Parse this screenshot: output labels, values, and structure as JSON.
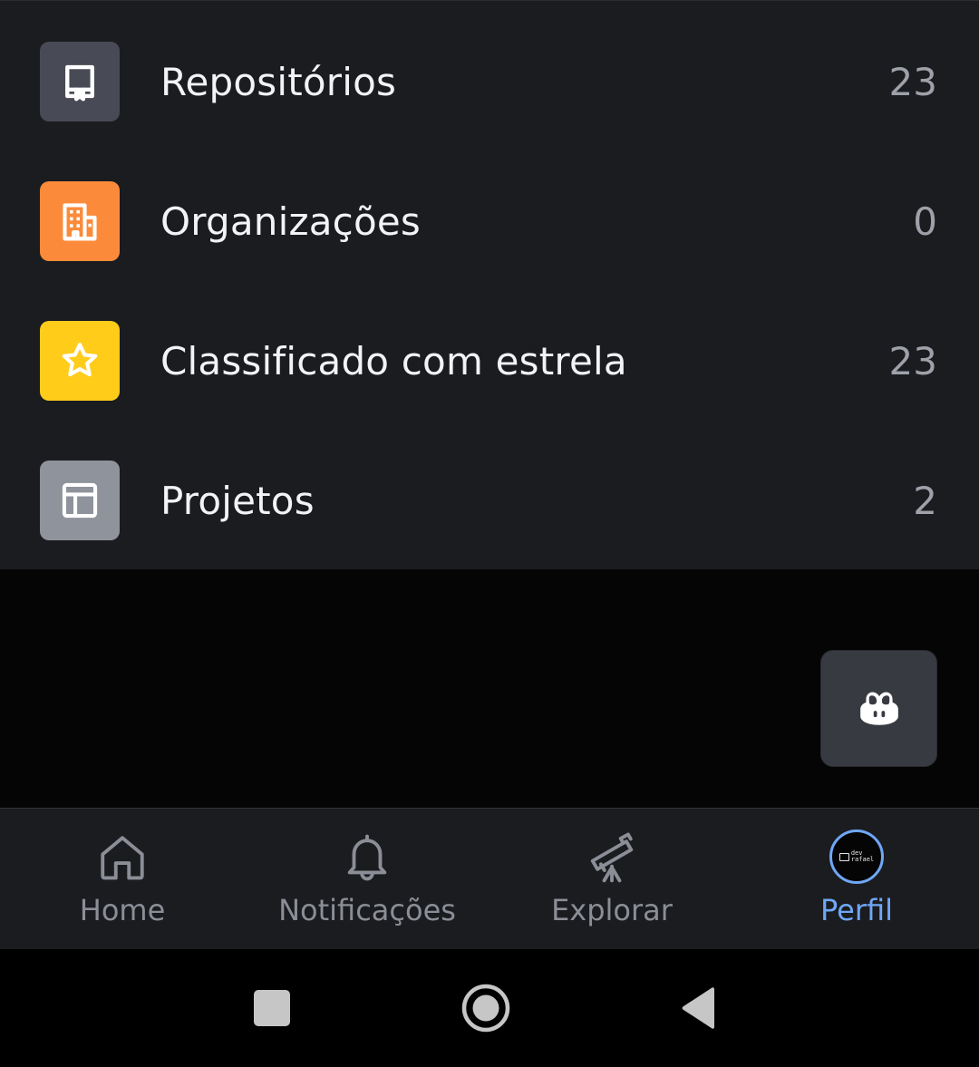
{
  "profile_list": {
    "items": [
      {
        "label": "Repositórios",
        "count": "23",
        "icon": "repo-icon",
        "icon_bg": "#484a55"
      },
      {
        "label": "Organizações",
        "count": "0",
        "icon": "organization-icon",
        "icon_bg": "#fb8b3a"
      },
      {
        "label": "Classificado com estrela",
        "count": "23",
        "icon": "star-icon",
        "icon_bg": "#ffcc1a"
      },
      {
        "label": "Projetos",
        "count": "2",
        "icon": "project-icon",
        "icon_bg": "#8f939c"
      }
    ]
  },
  "fab": {
    "icon": "copilot-icon"
  },
  "bottom_nav": {
    "items": [
      {
        "label": "Home",
        "icon": "home-icon",
        "active": false
      },
      {
        "label": "Notificações",
        "icon": "bell-icon",
        "active": false
      },
      {
        "label": "Explorar",
        "icon": "telescope-icon",
        "active": false
      },
      {
        "label": "Perfil",
        "icon": "avatar",
        "active": true
      }
    ],
    "avatar_text": {
      "line1": "dev",
      "line2": "rafael"
    }
  },
  "system_nav": {
    "buttons": [
      "recents-icon",
      "home-circle-icon",
      "back-triangle-icon"
    ]
  },
  "colors": {
    "list_bg": "#1b1c20",
    "page_bg": "#050505",
    "text_primary": "#f2f3f5",
    "text_count": "#9ea1a9",
    "nav_inactive": "#8b8e96",
    "accent": "#6fa7f5"
  }
}
